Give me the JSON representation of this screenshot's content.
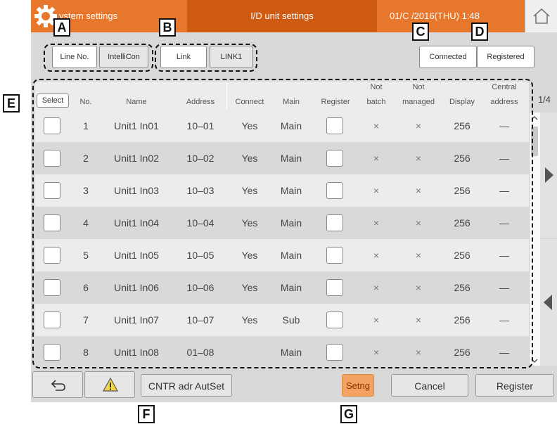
{
  "header": {
    "title_left": "ystem settings",
    "title_center": "I/D unit settings",
    "datetime": "01/C  /2016(THU)  1:48"
  },
  "topbar": {
    "line_no_label": "Line No.",
    "line_no_value": "IntelliCon",
    "link_label": "Link",
    "link_value": "LINK1",
    "connected_label": "Connected",
    "registered_label": "Registered"
  },
  "table": {
    "headers": {
      "select": "Select",
      "no": "No.",
      "name": "Name",
      "address": "Address",
      "connect": "Connect",
      "main": "Main",
      "register": "Register",
      "not_batch_1": "Not",
      "not_batch_2": "batch",
      "not_managed_1": "Not",
      "not_managed_2": "managed",
      "display": "Display",
      "central_1": "Central",
      "central_2": "address"
    },
    "page_indicator": "1/4",
    "rows": [
      {
        "no": "1",
        "name": "Unit1 In01",
        "address": "10–01",
        "connect": "Yes",
        "main": "Main",
        "not_batch": "×",
        "not_managed": "×",
        "display": "256",
        "central": "—"
      },
      {
        "no": "2",
        "name": "Unit1 In02",
        "address": "10–02",
        "connect": "Yes",
        "main": "Main",
        "not_batch": "×",
        "not_managed": "×",
        "display": "256",
        "central": "—"
      },
      {
        "no": "3",
        "name": "Unit1 In03",
        "address": "10–03",
        "connect": "Yes",
        "main": "Main",
        "not_batch": "×",
        "not_managed": "×",
        "display": "256",
        "central": "—"
      },
      {
        "no": "4",
        "name": "Unit1 In04",
        "address": "10–04",
        "connect": "Yes",
        "main": "Main",
        "not_batch": "×",
        "not_managed": "×",
        "display": "256",
        "central": "—"
      },
      {
        "no": "5",
        "name": "Unit1 In05",
        "address": "10–05",
        "connect": "Yes",
        "main": "Main",
        "not_batch": "×",
        "not_managed": "×",
        "display": "256",
        "central": "—"
      },
      {
        "no": "6",
        "name": "Unit1 In06",
        "address": "10–06",
        "connect": "Yes",
        "main": "Main",
        "not_batch": "×",
        "not_managed": "×",
        "display": "256",
        "central": "—"
      },
      {
        "no": "7",
        "name": "Unit1 In07",
        "address": "10–07",
        "connect": "Yes",
        "main": "Sub",
        "not_batch": "×",
        "not_managed": "×",
        "display": "256",
        "central": "—"
      },
      {
        "no": "8",
        "name": "Unit1 In08",
        "address": "01–08",
        "connect": "",
        "main": "Main",
        "not_batch": "×",
        "not_managed": "×",
        "display": "256",
        "central": "—"
      }
    ]
  },
  "bottombar": {
    "cntr_adr_label": "CNTR adr AutSet",
    "setng_label": "Setng",
    "cancel_label": "Cancel",
    "register_label": "Register"
  },
  "callouts": {
    "a": "A",
    "b": "B",
    "c": "C",
    "d": "D",
    "e": "E",
    "f": "F",
    "g": "G"
  },
  "colors": {
    "header_orange": "#e8772e",
    "header_dark_orange": "#cf5a12",
    "setng_orange": "#f4a261",
    "warning_yellow": "#f2d64b"
  },
  "icons": {
    "gear": "gear-icon",
    "home": "home-icon",
    "back": "back-arrow-icon",
    "warning": "warning-icon",
    "page_next": "triangle-right-icon",
    "page_prev": "triangle-left-icon",
    "scroll_up": "chevron-up-icon",
    "scroll_down": "chevron-down-icon"
  }
}
